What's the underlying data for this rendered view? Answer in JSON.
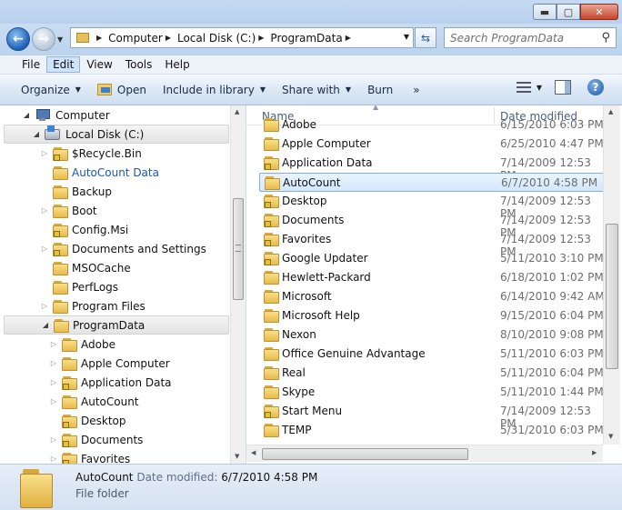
{
  "window": {
    "min_glyph": "▬",
    "max_glyph": "▢",
    "close_glyph": "✕"
  },
  "address": {
    "crumbs": [
      "Computer",
      "Local Disk (C:)",
      "ProgramData"
    ],
    "search_placeholder": "Search ProgramData"
  },
  "menu": {
    "items": [
      "File",
      "Edit",
      "View",
      "Tools",
      "Help"
    ],
    "active": "Edit"
  },
  "toolbar": {
    "organize": "Organize",
    "open": "Open",
    "include": "Include in library",
    "share": "Share with",
    "burn": "Burn",
    "more": "»"
  },
  "nav_tree": [
    {
      "label": "Computer",
      "indent": 0,
      "icon": "computer-icon",
      "expander": "open"
    },
    {
      "label": "Local Disk (C:)",
      "indent": 1,
      "icon": "disk-icon",
      "expander": "open",
      "selected": true
    },
    {
      "label": "$Recycle.Bin",
      "indent": 2,
      "icon": "folder-icon",
      "locked": true,
      "expander": "closed"
    },
    {
      "label": "AutoCount Data",
      "indent": 2,
      "icon": "folder-icon",
      "link": true
    },
    {
      "label": "Backup",
      "indent": 2,
      "icon": "folder-icon"
    },
    {
      "label": "Boot",
      "indent": 2,
      "icon": "folder-icon",
      "expander": "closed"
    },
    {
      "label": "Config.Msi",
      "indent": 2,
      "icon": "folder-icon",
      "locked": true
    },
    {
      "label": "Documents and Settings",
      "indent": 2,
      "icon": "folder-icon",
      "locked": true,
      "expander": "closed"
    },
    {
      "label": "MSOCache",
      "indent": 2,
      "icon": "folder-icon"
    },
    {
      "label": "PerfLogs",
      "indent": 2,
      "icon": "folder-icon"
    },
    {
      "label": "Program Files",
      "indent": 2,
      "icon": "folder-icon",
      "expander": "closed"
    },
    {
      "label": "ProgramData",
      "indent": 2,
      "icon": "folder-icon",
      "expander": "open",
      "selected": true
    },
    {
      "label": "Adobe",
      "indent": 3,
      "icon": "folder-icon",
      "expander": "closed"
    },
    {
      "label": "Apple Computer",
      "indent": 3,
      "icon": "folder-icon",
      "expander": "closed"
    },
    {
      "label": "Application Data",
      "indent": 3,
      "icon": "folder-icon",
      "locked": true,
      "expander": "closed"
    },
    {
      "label": "AutoCount",
      "indent": 3,
      "icon": "folder-icon",
      "expander": "closed"
    },
    {
      "label": "Desktop",
      "indent": 3,
      "icon": "folder-icon",
      "locked": true
    },
    {
      "label": "Documents",
      "indent": 3,
      "icon": "folder-icon",
      "locked": true,
      "expander": "closed"
    },
    {
      "label": "Favorites",
      "indent": 3,
      "icon": "folder-icon",
      "locked": true,
      "expander": "closed"
    }
  ],
  "file_list": {
    "columns": {
      "name": "Name",
      "date": "Date modified"
    },
    "rows": [
      {
        "name": "Adobe",
        "date": "6/15/2010 6:03 PM"
      },
      {
        "name": "Apple Computer",
        "date": "6/25/2010 4:47 PM"
      },
      {
        "name": "Application Data",
        "date": "7/14/2009 12:53 PM",
        "locked": true
      },
      {
        "name": "AutoCount",
        "date": "6/7/2010 4:58 PM",
        "selected": true
      },
      {
        "name": "Desktop",
        "date": "7/14/2009 12:53 PM",
        "locked": true
      },
      {
        "name": "Documents",
        "date": "7/14/2009 12:53 PM",
        "locked": true
      },
      {
        "name": "Favorites",
        "date": "7/14/2009 12:53 PM",
        "locked": true
      },
      {
        "name": "Google Updater",
        "date": "5/11/2010 3:10 PM",
        "locked": true
      },
      {
        "name": "Hewlett-Packard",
        "date": "6/18/2010 1:02 PM"
      },
      {
        "name": "Microsoft",
        "date": "6/14/2010 9:42 AM"
      },
      {
        "name": "Microsoft Help",
        "date": "9/15/2010 6:04 PM"
      },
      {
        "name": "Nexon",
        "date": "8/10/2010 9:08 PM"
      },
      {
        "name": "Office Genuine Advantage",
        "date": "5/11/2010 6:03 PM"
      },
      {
        "name": "Real",
        "date": "5/11/2010 6:04 PM"
      },
      {
        "name": "Skype",
        "date": "5/11/2010 1:44 PM"
      },
      {
        "name": "Start Menu",
        "date": "7/14/2009 12:53 PM",
        "locked": true
      },
      {
        "name": "TEMP",
        "date": "5/31/2010 6:03 PM"
      }
    ]
  },
  "details": {
    "name": "AutoCount",
    "modified_label": "Date modified:",
    "modified": "6/7/2010 4:58 PM",
    "type": "File folder"
  },
  "colors": {
    "accent": "#1c55b0",
    "selection": "#d3e7fc"
  }
}
